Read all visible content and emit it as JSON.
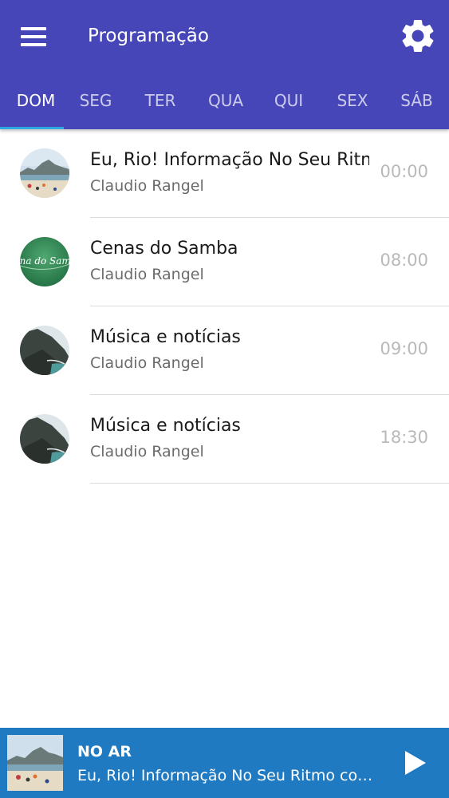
{
  "header": {
    "title": "Programação",
    "menu_icon": "hamburger-menu-icon",
    "settings_icon": "gear-icon"
  },
  "tabs": [
    {
      "label": "DOM",
      "active": true
    },
    {
      "label": "SEG",
      "active": false
    },
    {
      "label": "TER",
      "active": false
    },
    {
      "label": "QUA",
      "active": false
    },
    {
      "label": "QUI",
      "active": false
    },
    {
      "label": "SEX",
      "active": false
    },
    {
      "label": "SÁB",
      "active": false
    }
  ],
  "schedule": [
    {
      "title": "Eu, Rio! Informação No Seu Ritmo",
      "host": "Claudio Rangel",
      "time": "00:00",
      "thumb": "beach-photo"
    },
    {
      "title": "Cenas do Samba",
      "host": "Claudio Rangel",
      "time": "08:00",
      "thumb": "cenas-do-samba-logo",
      "thumb_text": "Cena do Samba"
    },
    {
      "title": "Música e notícias",
      "host": "Claudio Rangel",
      "time": "09:00",
      "thumb": "coast-photo"
    },
    {
      "title": "Música e notícias",
      "host": "Claudio Rangel",
      "time": "18:30",
      "thumb": "coast-photo"
    }
  ],
  "player": {
    "label": "NO AR",
    "track": "Eu, Rio! Informação No Seu Ritmo com Claudio Rangel",
    "play_icon": "play-icon"
  },
  "colors": {
    "appbar": "#4646b8",
    "tab_indicator": "#2fa8e0",
    "player": "#1f7ac2"
  }
}
